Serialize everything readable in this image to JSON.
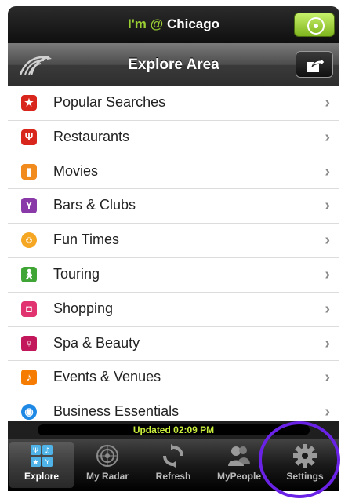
{
  "location": {
    "prefix": "I'm",
    "at": "@",
    "city": "Chicago"
  },
  "header": {
    "title": "Explore Area"
  },
  "categories": [
    {
      "label": "Popular Searches",
      "icon": "star-icon",
      "color": "#d9261c"
    },
    {
      "label": "Restaurants",
      "icon": "fork-knife-icon",
      "color": "#d9261c"
    },
    {
      "label": "Movies",
      "icon": "film-icon",
      "color": "#f28b1e"
    },
    {
      "label": "Bars & Clubs",
      "icon": "cocktail-icon",
      "color": "#8a3aa8"
    },
    {
      "label": "Fun Times",
      "icon": "smiley-icon",
      "color": "#f5a623"
    },
    {
      "label": "Touring",
      "icon": "walking-person-icon",
      "color": "#3fa535"
    },
    {
      "label": "Shopping",
      "icon": "shopping-bag-icon",
      "color": "#e0336f"
    },
    {
      "label": "Spa & Beauty",
      "icon": "spa-person-icon",
      "color": "#c2185b"
    },
    {
      "label": "Events & Venues",
      "icon": "music-note-icon",
      "color": "#f57c00"
    },
    {
      "label": "Business Essentials",
      "icon": "wifi-icon",
      "color": "#1e88e5"
    }
  ],
  "status": {
    "updated": "Updated 02:09 PM"
  },
  "tabs": [
    {
      "label": "Explore",
      "active": true
    },
    {
      "label": "My Radar"
    },
    {
      "label": "Refresh"
    },
    {
      "label": "MyPeople"
    },
    {
      "label": "Settings"
    }
  ],
  "colors": {
    "accent": "#9acd32",
    "highlight": "#6a22e6"
  }
}
